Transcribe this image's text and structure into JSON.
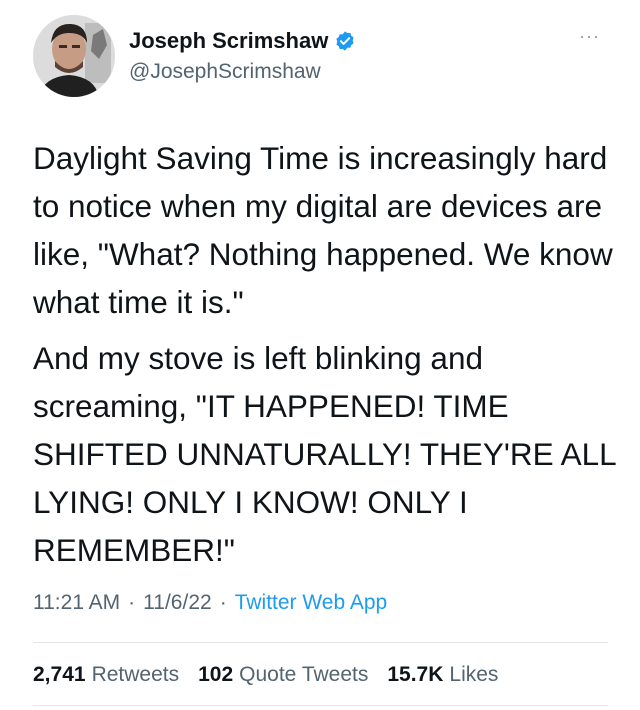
{
  "author": {
    "name": "Joseph Scrimshaw",
    "handle": "@JosephScrimshaw",
    "verified": true,
    "verified_color": "#1d9bf0"
  },
  "more_menu": {
    "icon": "more-dots-icon",
    "label": "···"
  },
  "tweet": {
    "paragraphs": [
      "Daylight Saving Time is increasingly hard to notice when my digital are devices are like, \"What? Nothing happened. We know what time it is.\"",
      "And my stove is left blinking and screaming, \"IT HAPPENED! TIME SHIFTED UNNATURALLY! THEY'RE ALL LYING! ONLY I KNOW! ONLY I REMEMBER!\""
    ]
  },
  "meta": {
    "time": "11:21 AM",
    "separator": "·",
    "date": "11/6/22",
    "source": "Twitter Web App",
    "link_color": "#1d9bf0"
  },
  "stats": {
    "retweets": {
      "count": "2,741",
      "label": "Retweets"
    },
    "quotes": {
      "count": "102",
      "label": "Quote Tweets"
    },
    "likes": {
      "count": "15.7K",
      "label": "Likes"
    }
  }
}
